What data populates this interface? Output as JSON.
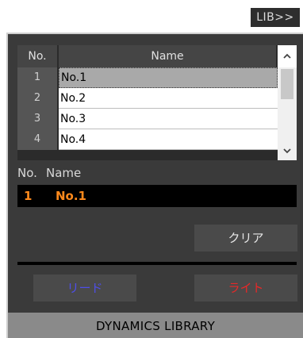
{
  "header": {
    "lib_button": "LIB>>"
  },
  "list": {
    "col_no": "No.",
    "col_name": "Name",
    "rows": [
      {
        "no": "1",
        "name": "No.1",
        "selected": true
      },
      {
        "no": "2",
        "name": "No.2"
      },
      {
        "no": "3",
        "name": "No.3"
      },
      {
        "no": "4",
        "name": "No.4"
      }
    ],
    "scroll_up_icon": "chevron-up-icon",
    "scroll_down_icon": "chevron-down-icon"
  },
  "current": {
    "no_label": "No.",
    "name_label": "Name",
    "no": "1",
    "name": "No.1"
  },
  "buttons": {
    "clear": "クリア",
    "read": "リード",
    "write": "ライト"
  },
  "footer": {
    "title": "DYNAMICS LIBRARY"
  },
  "colors": {
    "accent_orange": "#ff8a1c",
    "read_blue": "#4e4ee8",
    "write_red": "#e82828"
  }
}
